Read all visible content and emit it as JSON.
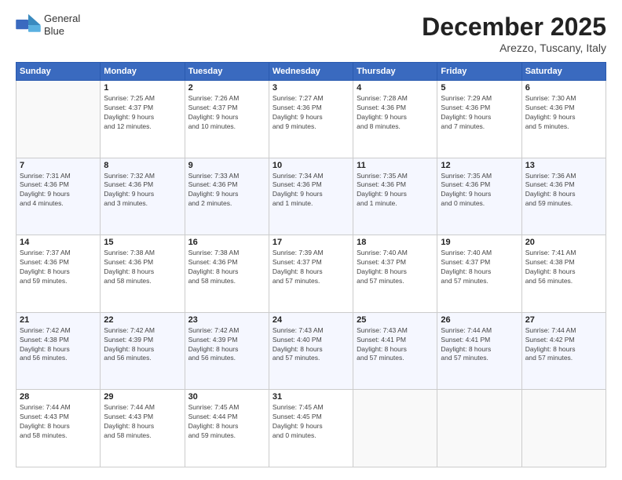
{
  "logo": {
    "line1": "General",
    "line2": "Blue"
  },
  "header": {
    "month": "December 2025",
    "location": "Arezzo, Tuscany, Italy"
  },
  "weekdays": [
    "Sunday",
    "Monday",
    "Tuesday",
    "Wednesday",
    "Thursday",
    "Friday",
    "Saturday"
  ],
  "weeks": [
    [
      {
        "day": "",
        "info": ""
      },
      {
        "day": "1",
        "info": "Sunrise: 7:25 AM\nSunset: 4:37 PM\nDaylight: 9 hours\nand 12 minutes."
      },
      {
        "day": "2",
        "info": "Sunrise: 7:26 AM\nSunset: 4:37 PM\nDaylight: 9 hours\nand 10 minutes."
      },
      {
        "day": "3",
        "info": "Sunrise: 7:27 AM\nSunset: 4:36 PM\nDaylight: 9 hours\nand 9 minutes."
      },
      {
        "day": "4",
        "info": "Sunrise: 7:28 AM\nSunset: 4:36 PM\nDaylight: 9 hours\nand 8 minutes."
      },
      {
        "day": "5",
        "info": "Sunrise: 7:29 AM\nSunset: 4:36 PM\nDaylight: 9 hours\nand 7 minutes."
      },
      {
        "day": "6",
        "info": "Sunrise: 7:30 AM\nSunset: 4:36 PM\nDaylight: 9 hours\nand 5 minutes."
      }
    ],
    [
      {
        "day": "7",
        "info": "Sunrise: 7:31 AM\nSunset: 4:36 PM\nDaylight: 9 hours\nand 4 minutes."
      },
      {
        "day": "8",
        "info": "Sunrise: 7:32 AM\nSunset: 4:36 PM\nDaylight: 9 hours\nand 3 minutes."
      },
      {
        "day": "9",
        "info": "Sunrise: 7:33 AM\nSunset: 4:36 PM\nDaylight: 9 hours\nand 2 minutes."
      },
      {
        "day": "10",
        "info": "Sunrise: 7:34 AM\nSunset: 4:36 PM\nDaylight: 9 hours\nand 1 minute."
      },
      {
        "day": "11",
        "info": "Sunrise: 7:35 AM\nSunset: 4:36 PM\nDaylight: 9 hours\nand 1 minute."
      },
      {
        "day": "12",
        "info": "Sunrise: 7:35 AM\nSunset: 4:36 PM\nDaylight: 9 hours\nand 0 minutes."
      },
      {
        "day": "13",
        "info": "Sunrise: 7:36 AM\nSunset: 4:36 PM\nDaylight: 8 hours\nand 59 minutes."
      }
    ],
    [
      {
        "day": "14",
        "info": "Sunrise: 7:37 AM\nSunset: 4:36 PM\nDaylight: 8 hours\nand 59 minutes."
      },
      {
        "day": "15",
        "info": "Sunrise: 7:38 AM\nSunset: 4:36 PM\nDaylight: 8 hours\nand 58 minutes."
      },
      {
        "day": "16",
        "info": "Sunrise: 7:38 AM\nSunset: 4:36 PM\nDaylight: 8 hours\nand 58 minutes."
      },
      {
        "day": "17",
        "info": "Sunrise: 7:39 AM\nSunset: 4:37 PM\nDaylight: 8 hours\nand 57 minutes."
      },
      {
        "day": "18",
        "info": "Sunrise: 7:40 AM\nSunset: 4:37 PM\nDaylight: 8 hours\nand 57 minutes."
      },
      {
        "day": "19",
        "info": "Sunrise: 7:40 AM\nSunset: 4:37 PM\nDaylight: 8 hours\nand 57 minutes."
      },
      {
        "day": "20",
        "info": "Sunrise: 7:41 AM\nSunset: 4:38 PM\nDaylight: 8 hours\nand 56 minutes."
      }
    ],
    [
      {
        "day": "21",
        "info": "Sunrise: 7:42 AM\nSunset: 4:38 PM\nDaylight: 8 hours\nand 56 minutes."
      },
      {
        "day": "22",
        "info": "Sunrise: 7:42 AM\nSunset: 4:39 PM\nDaylight: 8 hours\nand 56 minutes."
      },
      {
        "day": "23",
        "info": "Sunrise: 7:42 AM\nSunset: 4:39 PM\nDaylight: 8 hours\nand 56 minutes."
      },
      {
        "day": "24",
        "info": "Sunrise: 7:43 AM\nSunset: 4:40 PM\nDaylight: 8 hours\nand 57 minutes."
      },
      {
        "day": "25",
        "info": "Sunrise: 7:43 AM\nSunset: 4:41 PM\nDaylight: 8 hours\nand 57 minutes."
      },
      {
        "day": "26",
        "info": "Sunrise: 7:44 AM\nSunset: 4:41 PM\nDaylight: 8 hours\nand 57 minutes."
      },
      {
        "day": "27",
        "info": "Sunrise: 7:44 AM\nSunset: 4:42 PM\nDaylight: 8 hours\nand 57 minutes."
      }
    ],
    [
      {
        "day": "28",
        "info": "Sunrise: 7:44 AM\nSunset: 4:43 PM\nDaylight: 8 hours\nand 58 minutes."
      },
      {
        "day": "29",
        "info": "Sunrise: 7:44 AM\nSunset: 4:43 PM\nDaylight: 8 hours\nand 58 minutes."
      },
      {
        "day": "30",
        "info": "Sunrise: 7:45 AM\nSunset: 4:44 PM\nDaylight: 8 hours\nand 59 minutes."
      },
      {
        "day": "31",
        "info": "Sunrise: 7:45 AM\nSunset: 4:45 PM\nDaylight: 9 hours\nand 0 minutes."
      },
      {
        "day": "",
        "info": ""
      },
      {
        "day": "",
        "info": ""
      },
      {
        "day": "",
        "info": ""
      }
    ]
  ]
}
